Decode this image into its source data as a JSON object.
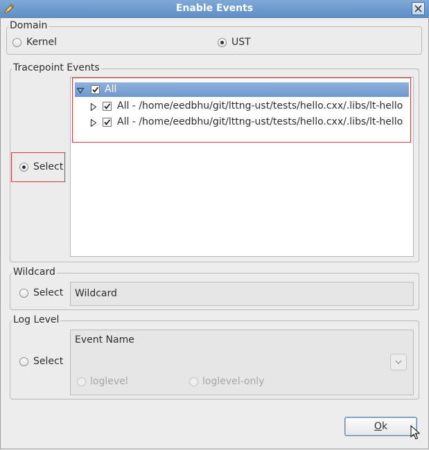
{
  "window": {
    "title": "Enable Events",
    "icon": "pencil-icon",
    "close_icon": "close-icon"
  },
  "domain": {
    "legend": "Domain",
    "options": [
      {
        "label": "Kernel",
        "selected": false
      },
      {
        "label": "UST",
        "selected": true
      }
    ]
  },
  "tracepoint": {
    "legend": "Tracepoint Events",
    "select_label": "Select",
    "select_selected": true,
    "tree": [
      {
        "label": "All",
        "checked": true,
        "expanded": true,
        "selected": true
      },
      {
        "label": "All - /home/eedbhu/git/lttng-ust/tests/hello.cxx/.libs/lt-hello",
        "checked": true,
        "expanded": false
      },
      {
        "label": "All - /home/eedbhu/git/lttng-ust/tests/hello.cxx/.libs/lt-hello",
        "checked": true,
        "expanded": false
      }
    ]
  },
  "wildcard": {
    "legend": "Wildcard",
    "select_label": "Select",
    "select_selected": false,
    "field_value": "Wildcard"
  },
  "loglevel": {
    "legend": "Log Level",
    "select_label": "Select",
    "select_selected": false,
    "event_name_label": "Event Name",
    "options": [
      {
        "label": "loglevel",
        "selected": false
      },
      {
        "label": "loglevel-only",
        "selected": false
      }
    ]
  },
  "buttons": {
    "ok_label": "Ok"
  },
  "colors": {
    "titlebar": "#6b98cc",
    "selection": "#7aa2d3",
    "highlight_box": "#d8343e"
  }
}
